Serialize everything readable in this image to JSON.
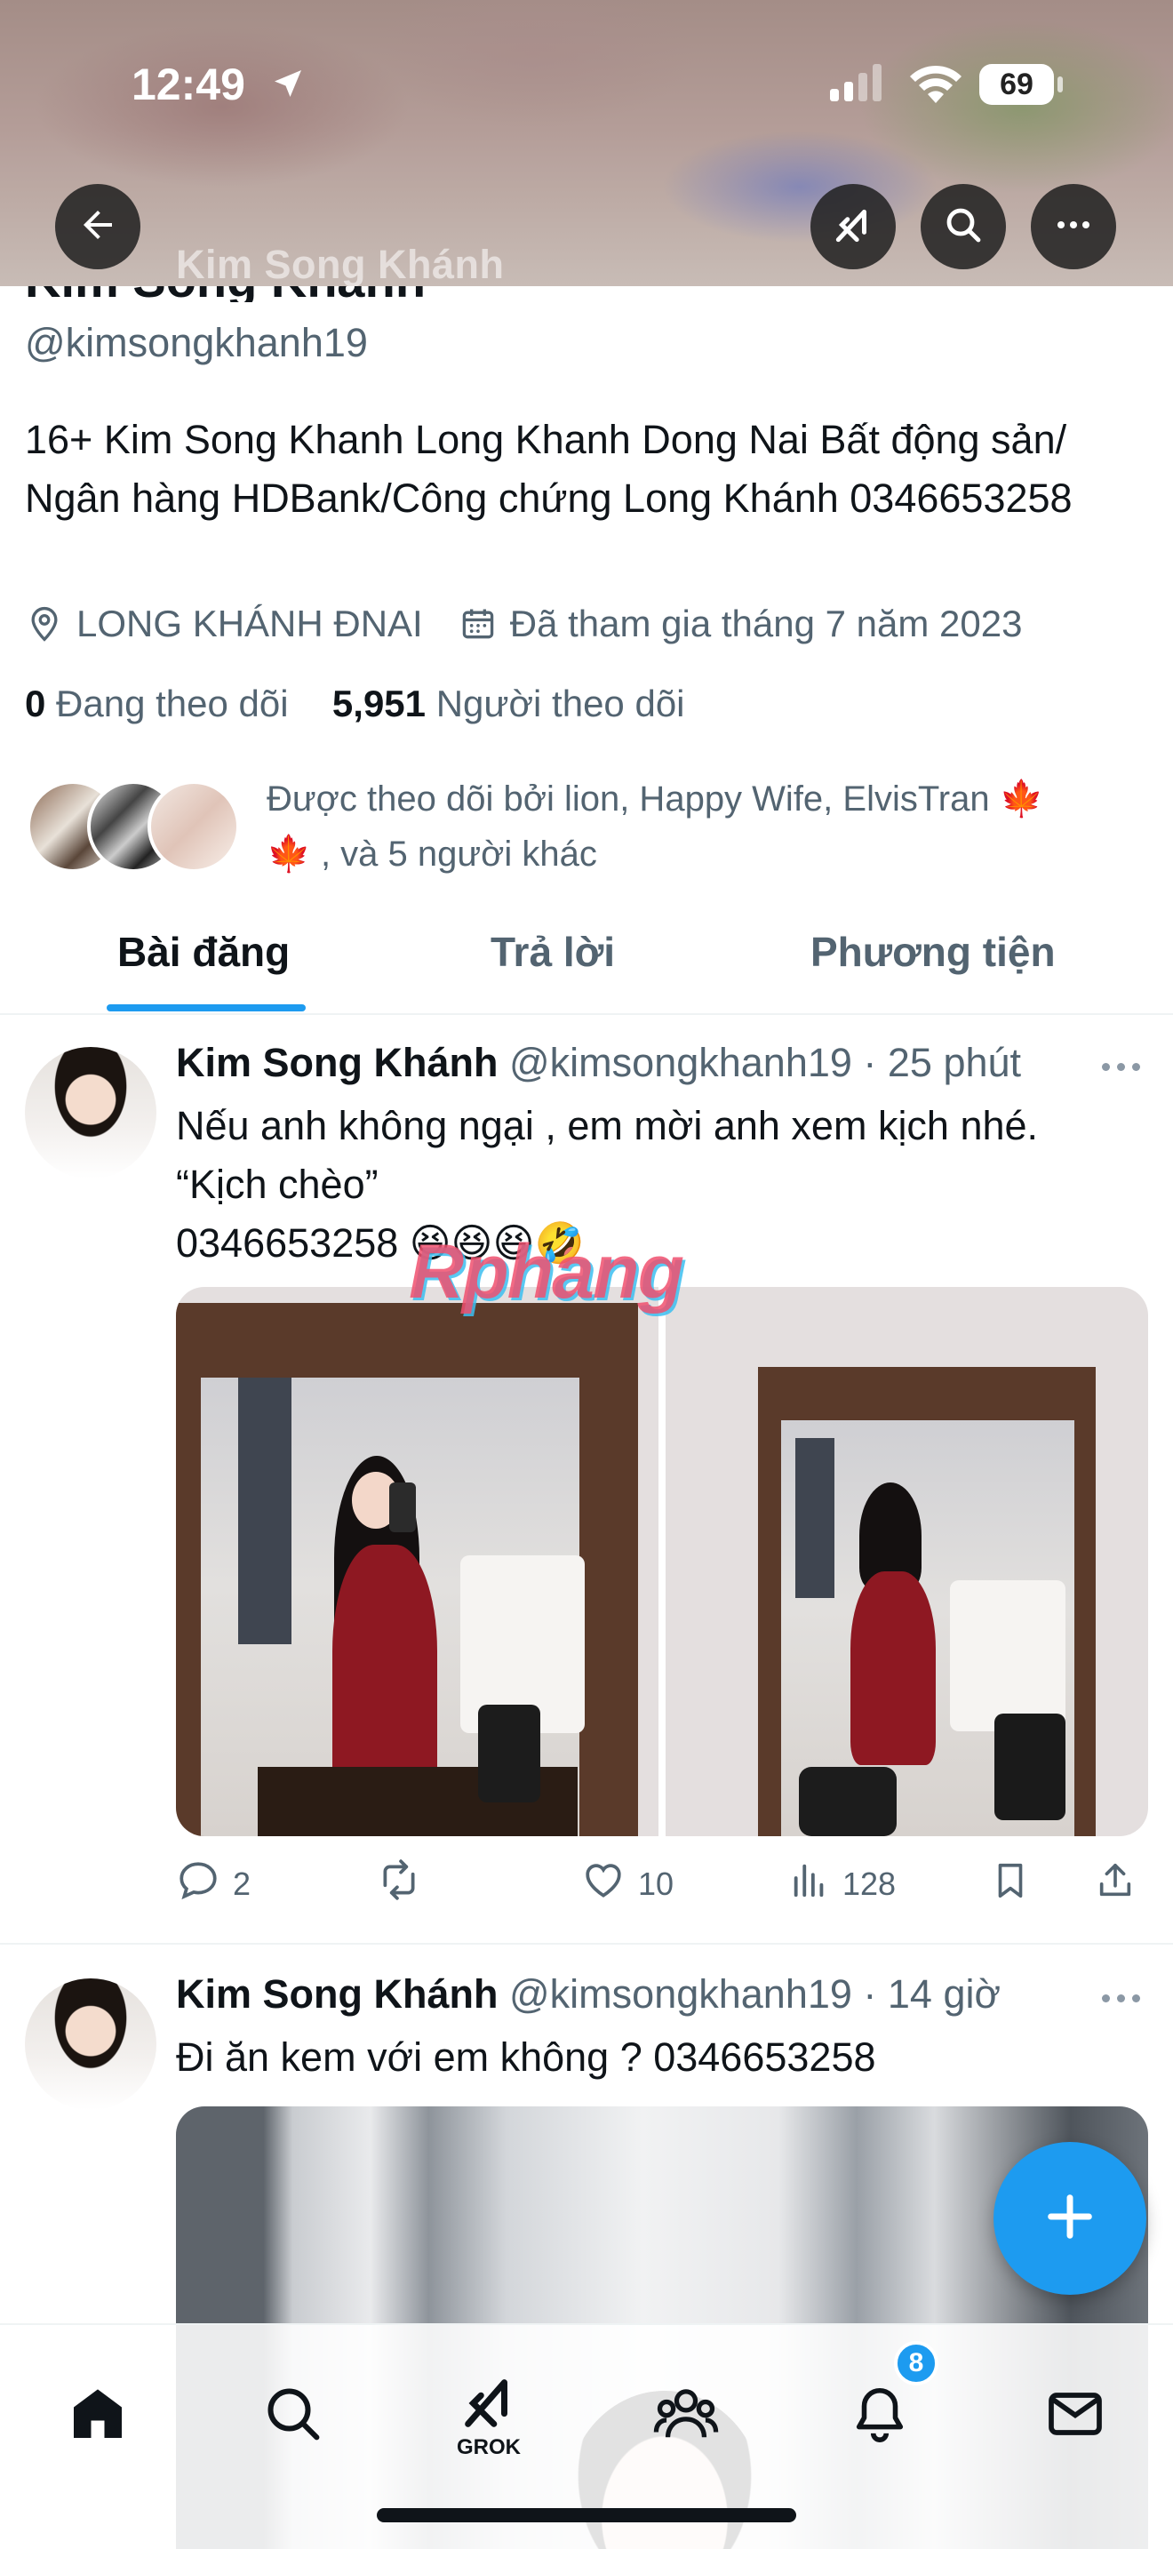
{
  "status_bar": {
    "time": "12:49",
    "battery": "69"
  },
  "header": {
    "banner_name": "Kim Song Khánh"
  },
  "profile": {
    "name": "Kim Song Khánh",
    "handle": "@kimsongkhanh19",
    "bio": "16+ Kim Song Khanh Long Khanh Dong Nai Bất động sản/ Ngân hàng HDBank/Công chứng Long Khánh 0346653258",
    "location": "LONG KHÁNH ĐNAI",
    "joined": "Đã tham gia tháng 7 năm 2023",
    "following_count": "0",
    "following_label": "Đang theo dõi",
    "followers_count": "5,951",
    "followers_label": "Người theo dõi",
    "followed_by_text": "Được theo dõi bởi lion, Happy Wife, ElvisTran",
    "followed_by_more": ", và 5 người khác"
  },
  "tabs": [
    {
      "label": "Bài đăng",
      "active": true
    },
    {
      "label": "Trả lời",
      "active": false
    },
    {
      "label": "Phương tiện",
      "active": false
    }
  ],
  "tweets": [
    {
      "name": "Kim Song Khánh",
      "meta": "@kimsongkhanh19 · 25 phút",
      "text_line1": "Nếu anh không ngại , em mời anh xem kịch nhé.",
      "text_line2": "“Kịch chèo”",
      "text_line3": "0346653258 😆😆😆🤣",
      "replies": "2",
      "likes": "10",
      "views": "128"
    },
    {
      "name": "Kim Song Khánh",
      "meta": "@kimsongkhanh19 · 14 giờ",
      "text_line1": "Đi ăn kem với em không ? 0346653258"
    }
  ],
  "watermark": "Rphang",
  "bottom_nav": {
    "grok_label": "GROK",
    "notifications_badge": "8"
  },
  "colors": {
    "accent": "#1d9bf0",
    "text_primary": "#0f1419",
    "text_secondary": "#536471"
  }
}
